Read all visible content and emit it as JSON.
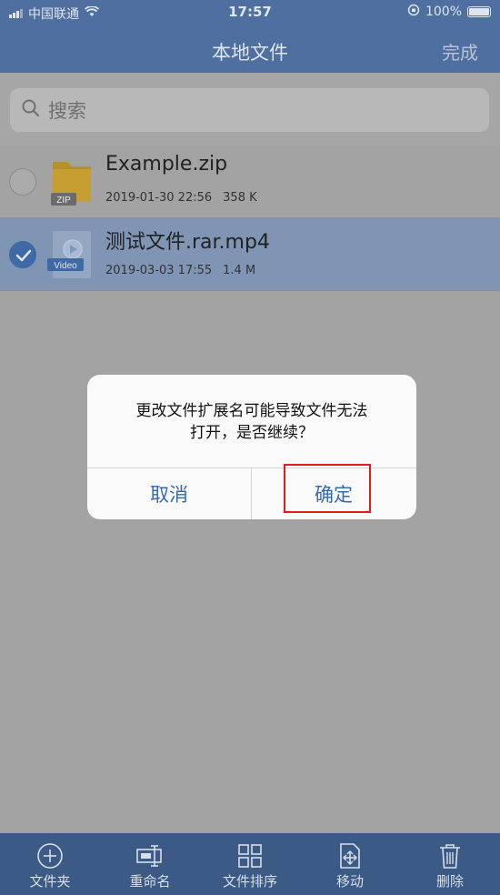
{
  "status_bar": {
    "carrier": "中国联通",
    "time": "17:57",
    "battery": "100%"
  },
  "nav": {
    "title": "本地文件",
    "done": "完成"
  },
  "search": {
    "placeholder": "搜索"
  },
  "files": [
    {
      "name": "Example.zip",
      "date": "2019-01-30 22:56",
      "size": "358 K",
      "icon_badge": "ZIP",
      "selected": false
    },
    {
      "name": "测试文件.rar.mp4",
      "date": "2019-03-03 17:55",
      "size": "1.4 M",
      "icon_badge": "Video",
      "selected": true
    }
  ],
  "dialog": {
    "message_line1": "更改文件扩展名可能导致文件无法",
    "message_line2": "打开，是否继续？",
    "cancel": "取消",
    "confirm": "确定"
  },
  "toolbar": {
    "folder": "文件夹",
    "rename": "重命名",
    "sort": "文件排序",
    "move": "移动",
    "delete": "删除"
  },
  "colors": {
    "accent": "#3568b6",
    "nav": "#4e6f9f",
    "highlight": "#e21b1b"
  }
}
